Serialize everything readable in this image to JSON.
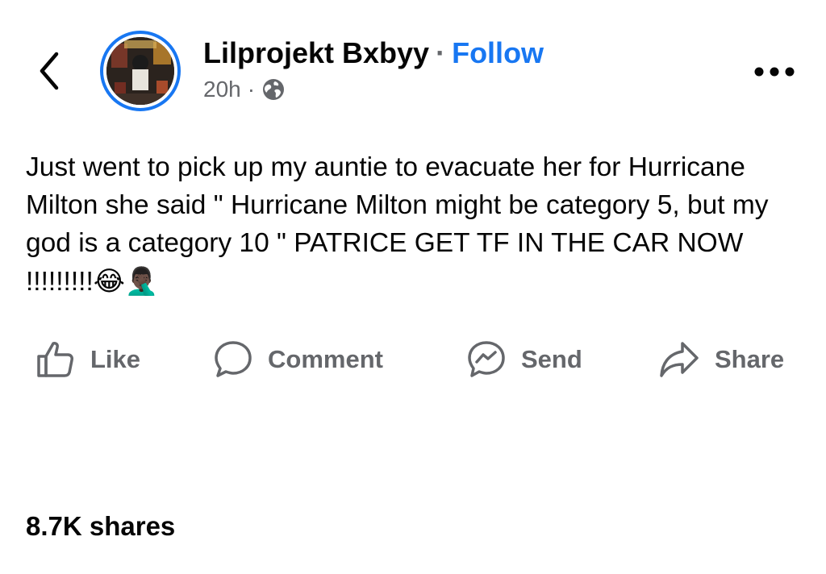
{
  "header": {
    "author_name": "Lilprojekt Bxbyy",
    "separator": "·",
    "follow_label": "Follow",
    "timestamp": "20h",
    "meta_separator": "·",
    "privacy_icon": "globe-icon",
    "back_icon": "chevron-left-icon",
    "more_icon": "more-horizontal-icon"
  },
  "post": {
    "text": "Just went to pick up my auntie to evacuate her for Hurricane Milton she said \" Hurricane Milton might be category 5, but my god is a category 10 \" PATRICE GET TF IN THE CAR NOW !!!!!!!!!",
    "emojis": "😂🤦🏿‍♂️"
  },
  "actions": [
    {
      "label": "Like",
      "icon": "thumbs-up-icon"
    },
    {
      "label": "Comment",
      "icon": "comment-icon"
    },
    {
      "label": "Send",
      "icon": "messenger-icon"
    },
    {
      "label": "Share",
      "icon": "share-arrow-icon"
    }
  ],
  "footer": {
    "shares_label": "8.7K shares"
  },
  "colors": {
    "accent": "#1877f2",
    "secondary_text": "#65676b",
    "primary_text": "#050505"
  }
}
